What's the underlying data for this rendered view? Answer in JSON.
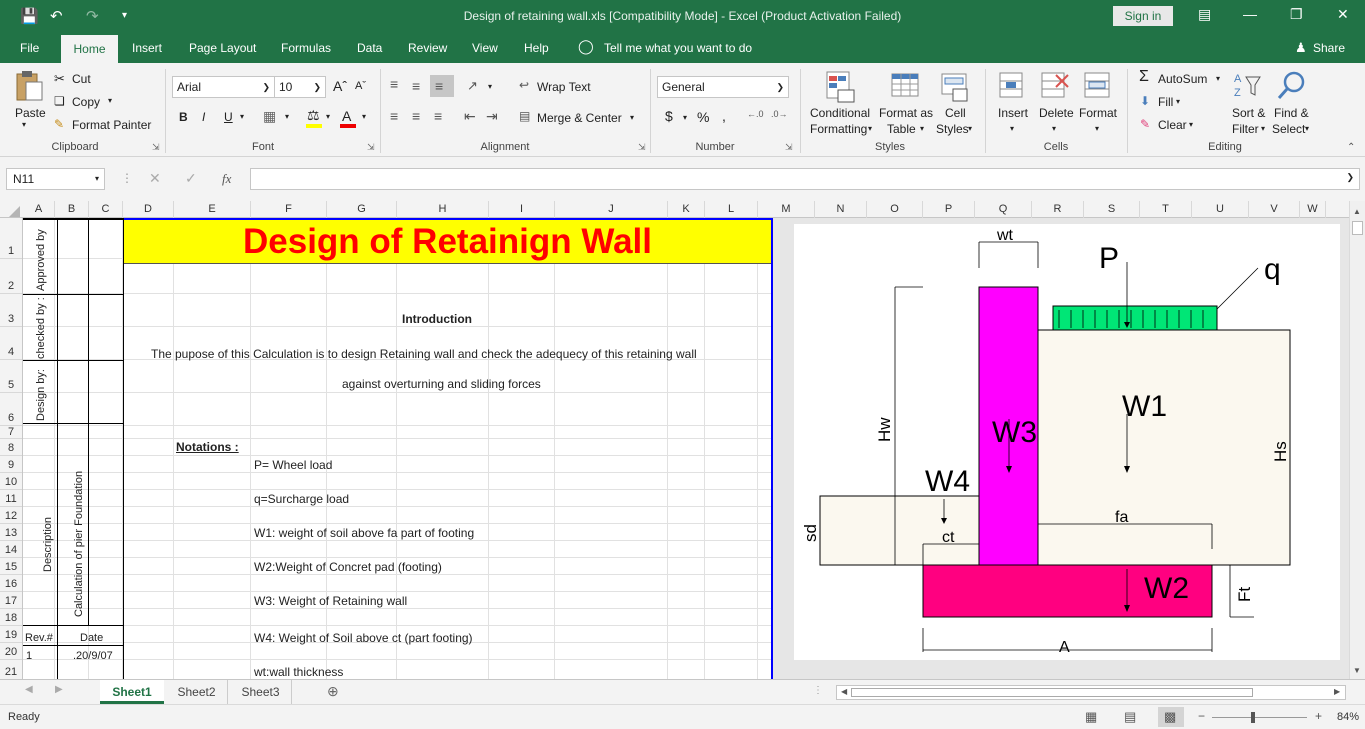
{
  "window": {
    "title": "Design of retaining wall.xls  [Compatibility Mode]  -  Excel (Product Activation Failed)",
    "sign_in": "Sign in",
    "accent": "#217346"
  },
  "tabs": {
    "file": "File",
    "home": "Home",
    "insert": "Insert",
    "page_layout": "Page Layout",
    "formulas": "Formulas",
    "data": "Data",
    "review": "Review",
    "view": "View",
    "help": "Help",
    "tell_me": "Tell me what you want to do",
    "share": "Share"
  },
  "ribbon": {
    "clipboard": {
      "paste": "Paste",
      "cut": "Cut",
      "copy": "Copy",
      "format_painter": "Format Painter",
      "label": "Clipboard"
    },
    "font": {
      "name": "Arial",
      "size": "10",
      "bold": "B",
      "italic": "I",
      "underline": "U",
      "label": "Font"
    },
    "alignment": {
      "wrap": "Wrap Text",
      "merge": "Merge & Center",
      "label": "Alignment"
    },
    "number": {
      "format": "General",
      "currency": "$",
      "percent": "%",
      "comma": ",",
      "label": "Number"
    },
    "styles": {
      "conditional_1": "Conditional",
      "conditional_2": "Formatting",
      "table_1": "Format as",
      "table_2": "Table",
      "cell_1": "Cell",
      "cell_2": "Styles",
      "label": "Styles"
    },
    "cells": {
      "insert": "Insert",
      "delete": "Delete",
      "format": "Format",
      "label": "Cells"
    },
    "editing": {
      "autosum": "AutoSum",
      "fill": "Fill",
      "clear": "Clear",
      "sort_1": "Sort &",
      "sort_2": "Filter",
      "find_1": "Find &",
      "find_2": "Select",
      "label": "Editing"
    }
  },
  "formula_bar": {
    "name_box": "N11",
    "fx": "fx",
    "value": ""
  },
  "columns": [
    "A",
    "B",
    "C",
    "D",
    "E",
    "F",
    "G",
    "H",
    "I",
    "J",
    "K",
    "L",
    "M",
    "N",
    "O",
    "P",
    "Q",
    "R",
    "S",
    "T",
    "U",
    "V",
    "W"
  ],
  "rows": [
    "1",
    "2",
    "3",
    "4",
    "5",
    "6",
    "7",
    "8",
    "9",
    "10",
    "11",
    "12",
    "13",
    "14",
    "15",
    "16",
    "17",
    "18",
    "19",
    "20",
    "21"
  ],
  "sheet": {
    "heading": "Design of Retainign Wall",
    "approved": "Approved by",
    "checked": "checked by :",
    "design_by": "Design by:",
    "description": "Description",
    "calc": "Calculation of pier Foundation",
    "rev": "Rev.#",
    "date": "Date",
    "rev_val": "1",
    "date_val": ".20/9/07",
    "introduction": "Introduction",
    "intro_line1": "The pupose of this Calculation is to design Retaining wall and check the adequecy of this retaining wall",
    "intro_line2": "against overturning and sliding forces",
    "notations": "Notations :",
    "notes": [
      "P= Wheel load",
      "q=Surcharge load",
      "W1: weight of soil above fa part of footing",
      "W2:Weight of Concret pad (footing)",
      "W3: Weight of Retaining wall",
      "W4: Weight of Soil above ct (part footing)",
      "wt:wall thickness"
    ]
  },
  "diagram": {
    "labels": {
      "wt": "wt",
      "p": "P",
      "q": "q",
      "w1": "W1",
      "w2": "W2",
      "w3": "W3",
      "w4": "W4",
      "hw": "Hw",
      "hs": "Hs",
      "sd": "sd",
      "ct": "ct",
      "fa": "fa",
      "ft": "Ft",
      "a": "A"
    },
    "colors": {
      "wall": "#ff00ff",
      "footing": "#ff0080",
      "surcharge": "#00e676",
      "soil": "#fbf8ef"
    }
  },
  "sheet_tabs": [
    "Sheet1",
    "Sheet2",
    "Sheet3"
  ],
  "status": {
    "ready": "Ready",
    "zoom": "84%"
  },
  "colors": {
    "title_fill": "#ffff00",
    "title_text": "#ff0000",
    "border": "#0000ff"
  }
}
